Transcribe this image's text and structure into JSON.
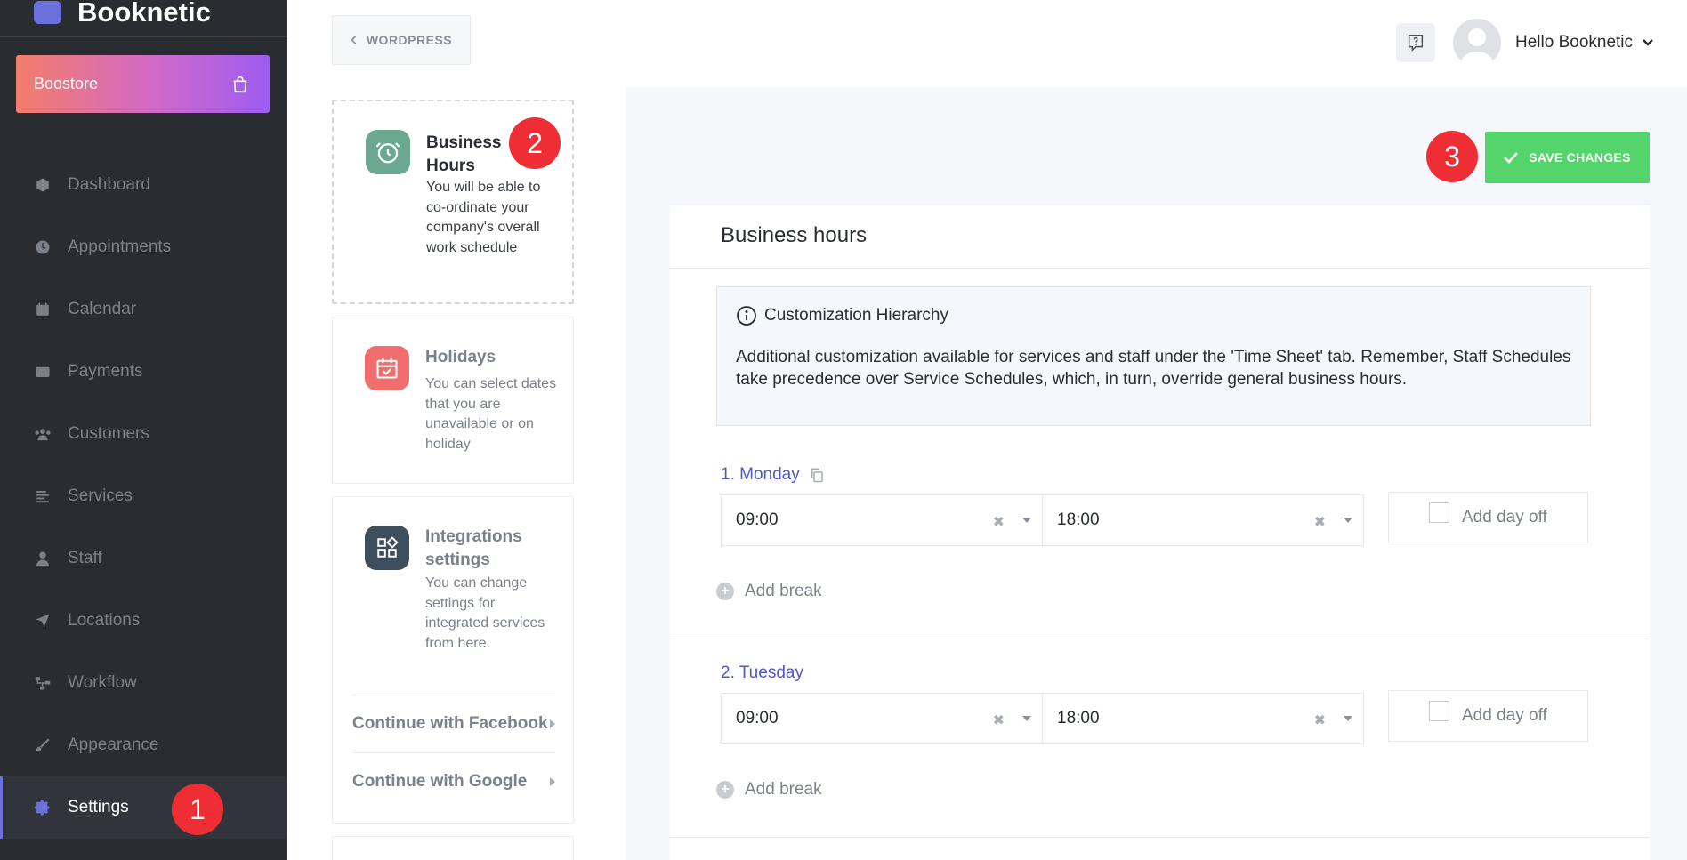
{
  "brand": {
    "name": "Booknetic"
  },
  "sidebar": {
    "boostore_label": "Boostore",
    "items": [
      {
        "label": "Dashboard",
        "icon": "cube-icon"
      },
      {
        "label": "Appointments",
        "icon": "clock-icon"
      },
      {
        "label": "Calendar",
        "icon": "calendar-icon"
      },
      {
        "label": "Payments",
        "icon": "wallet-icon"
      },
      {
        "label": "Customers",
        "icon": "users-icon"
      },
      {
        "label": "Services",
        "icon": "list-icon"
      },
      {
        "label": "Staff",
        "icon": "user-icon"
      },
      {
        "label": "Locations",
        "icon": "location-arrow-icon"
      },
      {
        "label": "Workflow",
        "icon": "workflow-icon"
      },
      {
        "label": "Appearance",
        "icon": "brush-icon"
      },
      {
        "label": "Settings",
        "icon": "gear-icon",
        "active": true
      }
    ]
  },
  "badges": {
    "one": "1",
    "two": "2",
    "three": "3"
  },
  "topbar": {
    "back_label": "WORDPRESS",
    "user_greeting": "Hello Booknetic"
  },
  "menu": {
    "business_hours": {
      "title": "Business Hours",
      "desc": "You will be able to co-ordinate your company's overall work schedule"
    },
    "holidays": {
      "title": "Holidays",
      "desc": "You can select dates that you are unavailable or on holiday"
    },
    "integrations": {
      "title": "Integrations settings",
      "desc": "You can change settings for integrated services from here.",
      "links": [
        "Continue with Facebook",
        "Continue with Google"
      ]
    }
  },
  "main": {
    "save_label": "SAVE CHANGES",
    "panel_title": "Business hours",
    "info": {
      "title": "Customization Hierarchy",
      "text": "Additional customization available for services and staff under the 'Time Sheet' tab. Remember, Staff Schedules take precedence over Service Schedules, which, in turn, override general business hours."
    },
    "days": [
      {
        "label": "1. Monday",
        "start": "09:00",
        "end": "18:00",
        "dayoff_label": "Add day off",
        "break_label": "Add break"
      },
      {
        "label": "2. Tuesday",
        "start": "09:00",
        "end": "18:00",
        "dayoff_label": "Add day off",
        "break_label": "Add break"
      }
    ]
  },
  "colors": {
    "sidebar_bg": "#292d32",
    "accent": "#6c70dc",
    "save_green": "#53d56c",
    "badge_red": "#ee2d34",
    "business_icon": "#6aa890",
    "holidays_icon": "#f26d6d",
    "integrations_icon": "#3d4f5c"
  }
}
